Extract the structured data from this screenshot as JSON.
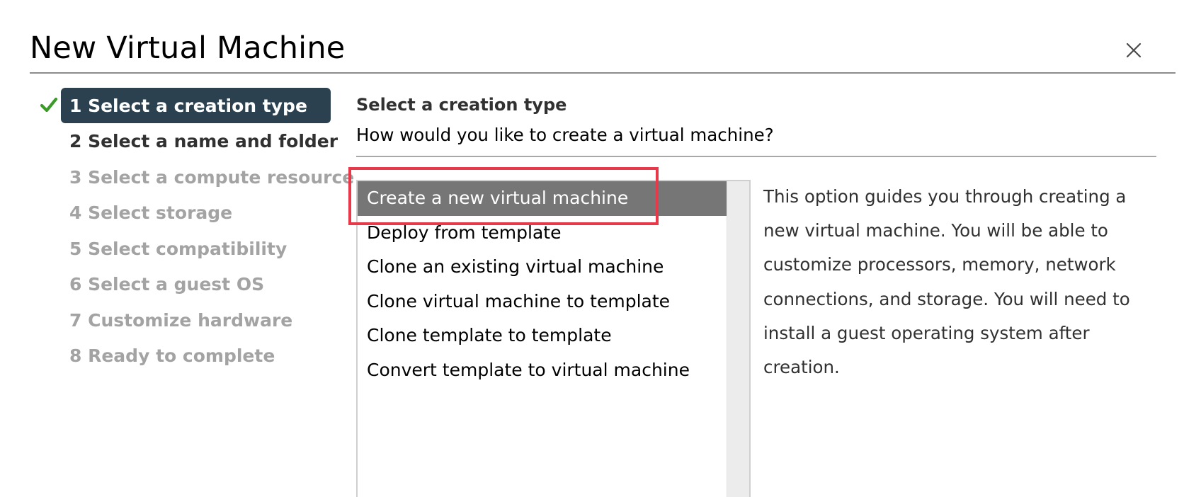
{
  "dialog": {
    "title": "New Virtual Machine"
  },
  "steps": [
    {
      "label": "1 Select a creation type",
      "state": "active",
      "completed": true
    },
    {
      "label": "2 Select a name and folder",
      "state": "current"
    },
    {
      "label": "3 Select a compute resource",
      "state": "disabled"
    },
    {
      "label": "4 Select storage",
      "state": "disabled"
    },
    {
      "label": "5 Select compatibility",
      "state": "disabled"
    },
    {
      "label": "6 Select a guest OS",
      "state": "disabled"
    },
    {
      "label": "7 Customize hardware",
      "state": "disabled"
    },
    {
      "label": "8 Ready to complete",
      "state": "disabled"
    }
  ],
  "main": {
    "section_title": "Select a creation type",
    "question": "How would you like to create a virtual machine?",
    "options": [
      {
        "label": "Create a new virtual machine",
        "selected": true
      },
      {
        "label": "Deploy from template",
        "selected": false
      },
      {
        "label": "Clone an existing virtual machine",
        "selected": false
      },
      {
        "label": "Clone virtual machine to template",
        "selected": false
      },
      {
        "label": "Clone template to template",
        "selected": false
      },
      {
        "label": "Convert template to virtual machine",
        "selected": false
      }
    ],
    "description": "This option guides you through creating a new virtual machine. You will be able to customize processors, memory, network connections, and storage. You will need to install a guest operating system after creation."
  },
  "icons": {
    "close": "close-icon",
    "check": "checkmark-icon"
  },
  "colors": {
    "active_step_bg": "#2b4150",
    "selected_option_bg": "#767676",
    "check_green": "#3c9a2b",
    "highlight_red": "#e8394a"
  }
}
